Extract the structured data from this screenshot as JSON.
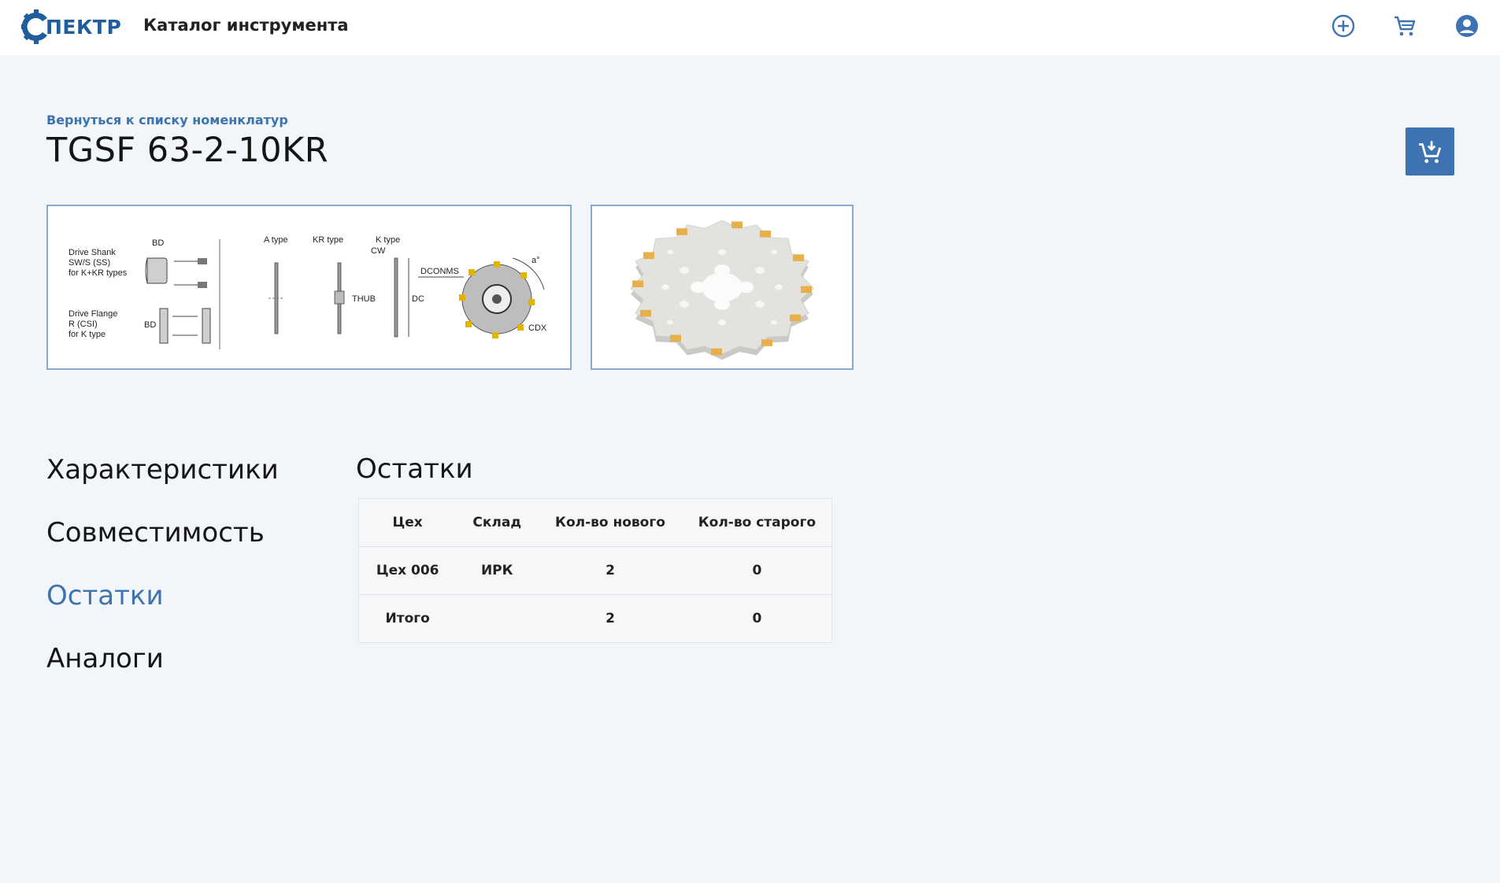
{
  "header": {
    "logo_text": "ПЕКТР",
    "app_title": "Каталог инструмента",
    "icons": [
      "add-circle-icon",
      "cart-icon",
      "account-icon"
    ],
    "accent_color": "#3d72b3"
  },
  "page": {
    "back_link": "Вернуться к списку номенклатур",
    "title": "TGSF 63-2-10KR"
  },
  "diagram": {
    "label_bd_top": "BD",
    "label_drive_shank": [
      "Drive Shank",
      "SW/S (SS)",
      "for K+KR types"
    ],
    "label_drive_flange": [
      "Drive Flange",
      "R (CSI)",
      "for K type"
    ],
    "label_bd_bottom": "BD",
    "label_a_type": "A type",
    "label_kr_type": "KR type",
    "label_k_type": "K type",
    "label_cw": "CW",
    "label_thub": "THUB",
    "label_dc": "DC",
    "label_dconms": "DCONMS",
    "label_cdx": "CDX",
    "label_angle": "a°"
  },
  "nav": {
    "items": [
      {
        "label": "Характеристики",
        "active": false
      },
      {
        "label": "Совместимость",
        "active": false
      },
      {
        "label": "Остатки",
        "active": true
      },
      {
        "label": "Аналоги",
        "active": false
      }
    ]
  },
  "section": {
    "title": "Остатки"
  },
  "table": {
    "headers": [
      "Цех",
      "Склад",
      "Кол-во нового",
      "Кол-во старого"
    ],
    "rows": [
      [
        "Цех 006",
        "ИРК",
        "2",
        "0"
      ],
      [
        "Итого",
        "",
        "2",
        "0"
      ]
    ]
  }
}
